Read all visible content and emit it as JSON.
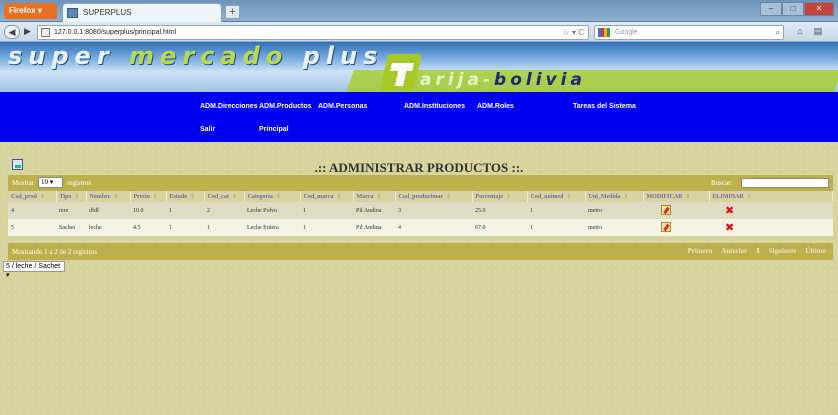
{
  "browser": {
    "firefox_button": "Firefox",
    "tab_title": "SUPERPLUS",
    "url": "127.0.0.1:8080/superplus/principal.html",
    "search_placeholder": "Google"
  },
  "site": {
    "brand_part1": "super ",
    "brand_part2": "mercado",
    "brand_part3": " plus",
    "brand_region_1": "arija-",
    "brand_region_2": "bolivia"
  },
  "menu": {
    "items": [
      {
        "label": "ADM.Direcciones"
      },
      {
        "label": "ADM.Productos"
      },
      {
        "label": "ADM.Personas"
      },
      {
        "label": "ADM.Instituciones"
      },
      {
        "label": "ADM.Roles"
      },
      {
        "label": "Tareas del Sistema"
      },
      {
        "label": "Salir"
      },
      {
        "label": "Principal"
      }
    ]
  },
  "page": {
    "title": ".:: ADMINISTRAR PRODUCTOS ::."
  },
  "table_controls": {
    "show_label": "Mostrar",
    "show_value": "10",
    "show_suffix": "registros",
    "search_label": "Buscar:",
    "search_value": ""
  },
  "table": {
    "columns": [
      "Cod_prod",
      "Tipo",
      "Nombre",
      "Precio",
      "Estado",
      "Cod_cat",
      "Categoria",
      "Cod_marca",
      "Marca",
      "Cod_productmar",
      "Porcentaje",
      "Cod_unimed",
      "Uni_Medida",
      "MODIFICAR",
      "ELIMINAR"
    ],
    "rows": [
      [
        "4",
        "rere",
        "dfdf",
        "10.0",
        "1",
        "2",
        "Leche Polvo",
        "1",
        "Pil Andina",
        "3",
        "25.0",
        "1",
        "metro"
      ],
      [
        "5",
        "Sachet",
        "leche",
        "4.5",
        "1",
        "1",
        "Leche Entera",
        "1",
        "Pil Andina",
        "4",
        "67.0",
        "1",
        "metro"
      ]
    ]
  },
  "table_footer": {
    "info": "Mostrando 1 a 2 de 2 registros",
    "pager": [
      "Primero",
      "Anterior",
      "1",
      "Siguiente",
      "Último"
    ]
  },
  "filter": {
    "selected": "5 / leche / Sachet"
  },
  "colors": {
    "menu_bg": "#0000f0",
    "table_bar": "#bdb04c",
    "content_bg": "#d6d49d",
    "delete_icon": "#e01010"
  }
}
